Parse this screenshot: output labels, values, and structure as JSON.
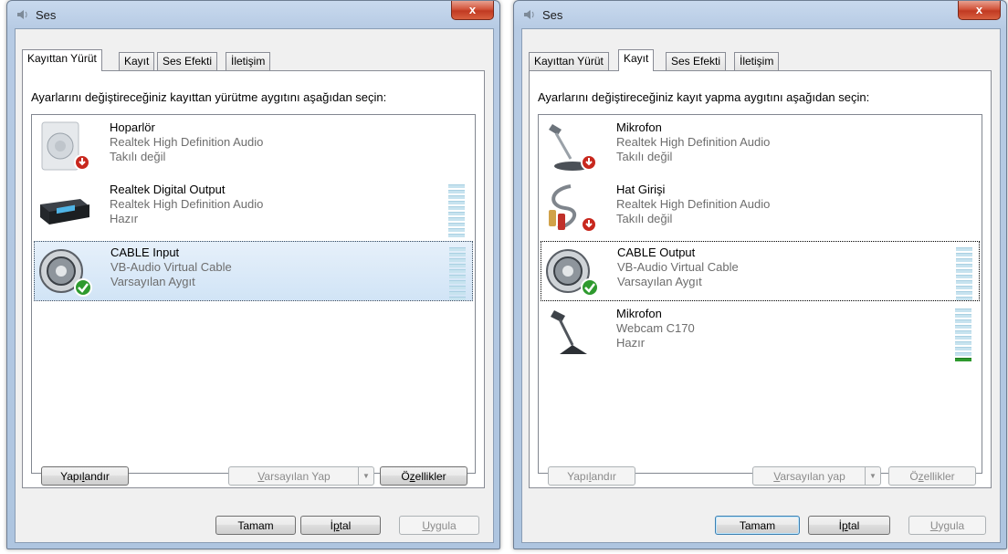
{
  "left": {
    "title": "Ses",
    "close": "x",
    "tabs": [
      "Kayıttan Yürüt",
      "Kayıt",
      "Ses Efekti",
      "İletişim"
    ],
    "instruction": "Ayarlarını değiştireceğiniz kayıttan yürütme aygıtını aşağıdan seçin:",
    "devices": [
      {
        "name": "Hoparlör",
        "sub": "Realtek High Definition Audio",
        "state": "Takılı değil",
        "icon": "speaker-icon"
      },
      {
        "name": "Realtek Digital Output",
        "sub": "Realtek High Definition Audio",
        "state": "Hazır",
        "icon": "receiver-icon"
      },
      {
        "name": "CABLE Input",
        "sub": "VB-Audio Virtual Cable",
        "state": "Varsayılan Aygıt",
        "icon": "cable-icon"
      }
    ],
    "buttons": {
      "configure_pre": "Yapı",
      "configure_u": "l",
      "configure_post": "andır",
      "set_default_u": "V",
      "set_default_post": "arsayılan Yap",
      "properties_pre": "Ö",
      "properties_u": "z",
      "properties_post": "ellikler",
      "ok": "Tamam",
      "cancel_pre": "İ",
      "cancel_u": "p",
      "cancel_post": "tal",
      "apply_u": "U",
      "apply_post": "ygula"
    }
  },
  "right": {
    "title": "Ses",
    "close": "x",
    "tabs": [
      "Kayıttan Yürüt",
      "Kayıt",
      "Ses Efekti",
      "İletişim"
    ],
    "instruction": "Ayarlarını değiştireceğiniz kayıt yapma aygıtını aşağıdan seçin:",
    "devices": [
      {
        "name": "Mikrofon",
        "sub": "Realtek High Definition Audio",
        "state": "Takılı değil",
        "icon": "microphone-icon"
      },
      {
        "name": "Hat Girişi",
        "sub": "Realtek High Definition Audio",
        "state": "Takılı değil",
        "icon": "line-in-icon"
      },
      {
        "name": "CABLE Output",
        "sub": "VB-Audio Virtual Cable",
        "state": "Varsayılan Aygıt",
        "icon": "cable-icon"
      },
      {
        "name": "Mikrofon",
        "sub": "Webcam C170",
        "state": "Hazır",
        "icon": "microphone-icon"
      }
    ],
    "buttons": {
      "configure_pre": "Yapı",
      "configure_u": "l",
      "configure_post": "andır",
      "set_default_u": "V",
      "set_default_post": "arsayılan yap",
      "properties_pre": "Ö",
      "properties_u": "z",
      "properties_post": "ellikler",
      "ok": "Tamam",
      "cancel_pre": "İ",
      "cancel_u": "p",
      "cancel_post": "tal",
      "apply_u": "U",
      "apply_post": "ygula"
    }
  },
  "colors": {
    "accent": "#3c7fb1",
    "status_ok": "#2e9a2e",
    "status_error": "#c8281e"
  }
}
